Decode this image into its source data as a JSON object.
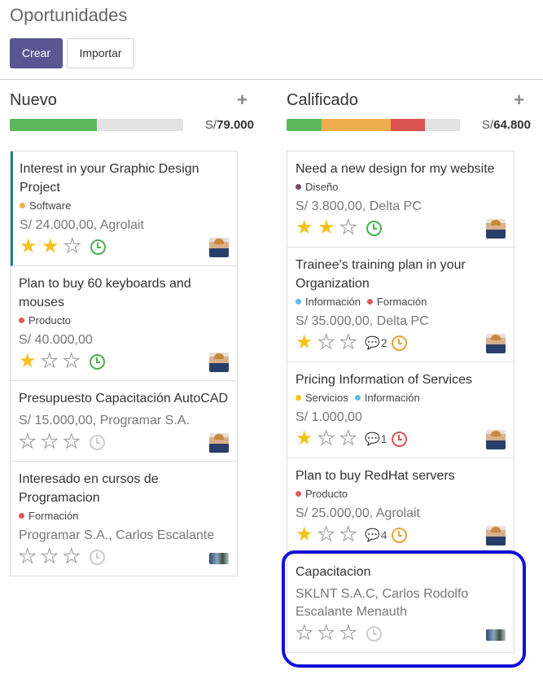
{
  "page": {
    "title": "Oportunidades"
  },
  "toolbar": {
    "create_label": "Crear",
    "import_label": "Importar"
  },
  "columns": [
    {
      "title": "Nuevo",
      "plus": "+",
      "currency": "S/",
      "total": "79.000",
      "progress": [
        {
          "color": "#5cb85c",
          "fraction": 0.5
        }
      ],
      "cards": [
        {
          "name": "Interest in your Graphic Design Project",
          "tags": [
            {
              "label": "Software",
              "color": "#f0ad4e"
            }
          ],
          "amount": "S/ 24.000,00, Agrolait",
          "stars": 2,
          "messages": "",
          "activity": "green",
          "avatar": "person",
          "accent": true
        },
        {
          "name": "Plan to buy 60 keyboards and mouses",
          "tags": [
            {
              "label": "Producto",
              "color": "#e05a5a"
            }
          ],
          "amount": "S/ 40.000,00",
          "stars": 1,
          "messages": "",
          "activity": "green",
          "avatar": "person",
          "accent": false
        },
        {
          "name": "Presupuesto Capacitación AutoCAD",
          "tags": [],
          "amount": "S/ 15.000,00, Programar S.A.",
          "stars": 0,
          "messages": "",
          "activity": "grey",
          "avatar": "person",
          "accent": false
        },
        {
          "name": "Interesado en cursos de Programacion",
          "tags": [
            {
              "label": "Formación",
              "color": "#e05a5a"
            }
          ],
          "amount": "Programar S.A., Carlos Escalante",
          "stars": 0,
          "messages": "",
          "activity": "grey",
          "avatar": "photo",
          "accent": false
        }
      ]
    },
    {
      "title": "Calificado",
      "plus": "+",
      "currency": "S/",
      "total": "64.800",
      "progress": [
        {
          "color": "#5cb85c",
          "fraction": 0.2
        },
        {
          "color": "#f0ad4e",
          "fraction": 0.4
        },
        {
          "color": "#d9534f",
          "fraction": 0.2
        }
      ],
      "cards": [
        {
          "name": "Need a new design for my website",
          "tags": [
            {
              "label": "Diseño",
              "color": "#7a4a6a"
            }
          ],
          "amount": "S/ 3.800,00, Delta PC",
          "stars": 2,
          "messages": "",
          "activity": "green",
          "avatar": "person",
          "accent": false
        },
        {
          "name": "Trainee's training plan in your Organization",
          "tags": [
            {
              "label": "Información",
              "color": "#5bc0de"
            },
            {
              "label": "Formación",
              "color": "#e05a5a"
            }
          ],
          "amount": "S/ 35.000,00, Delta PC",
          "stars": 1,
          "messages": "2",
          "activity": "orange",
          "avatar": "person",
          "accent": false
        },
        {
          "name": "Pricing Information of Services",
          "tags": [
            {
              "label": "Servicios",
              "color": "#f5c11b"
            },
            {
              "label": "Información",
              "color": "#5bc0de"
            }
          ],
          "amount": "S/ 1.000,00",
          "stars": 1,
          "messages": "1",
          "activity": "red",
          "avatar": "person",
          "accent": false
        },
        {
          "name": "Plan to buy RedHat servers",
          "tags": [
            {
              "label": "Producto",
              "color": "#e05a5a"
            }
          ],
          "amount": "S/ 25.000,00, Agrolait",
          "stars": 1,
          "messages": "4",
          "activity": "orange",
          "avatar": "person",
          "accent": false
        },
        {
          "name": "Capacitacion",
          "tags": [],
          "amount": "SKLNT S.A.C, Carlos Rodolfo Escalante Menauth",
          "stars": 0,
          "messages": "",
          "activity": "grey",
          "avatar": "photo",
          "accent": false
        }
      ]
    }
  ]
}
